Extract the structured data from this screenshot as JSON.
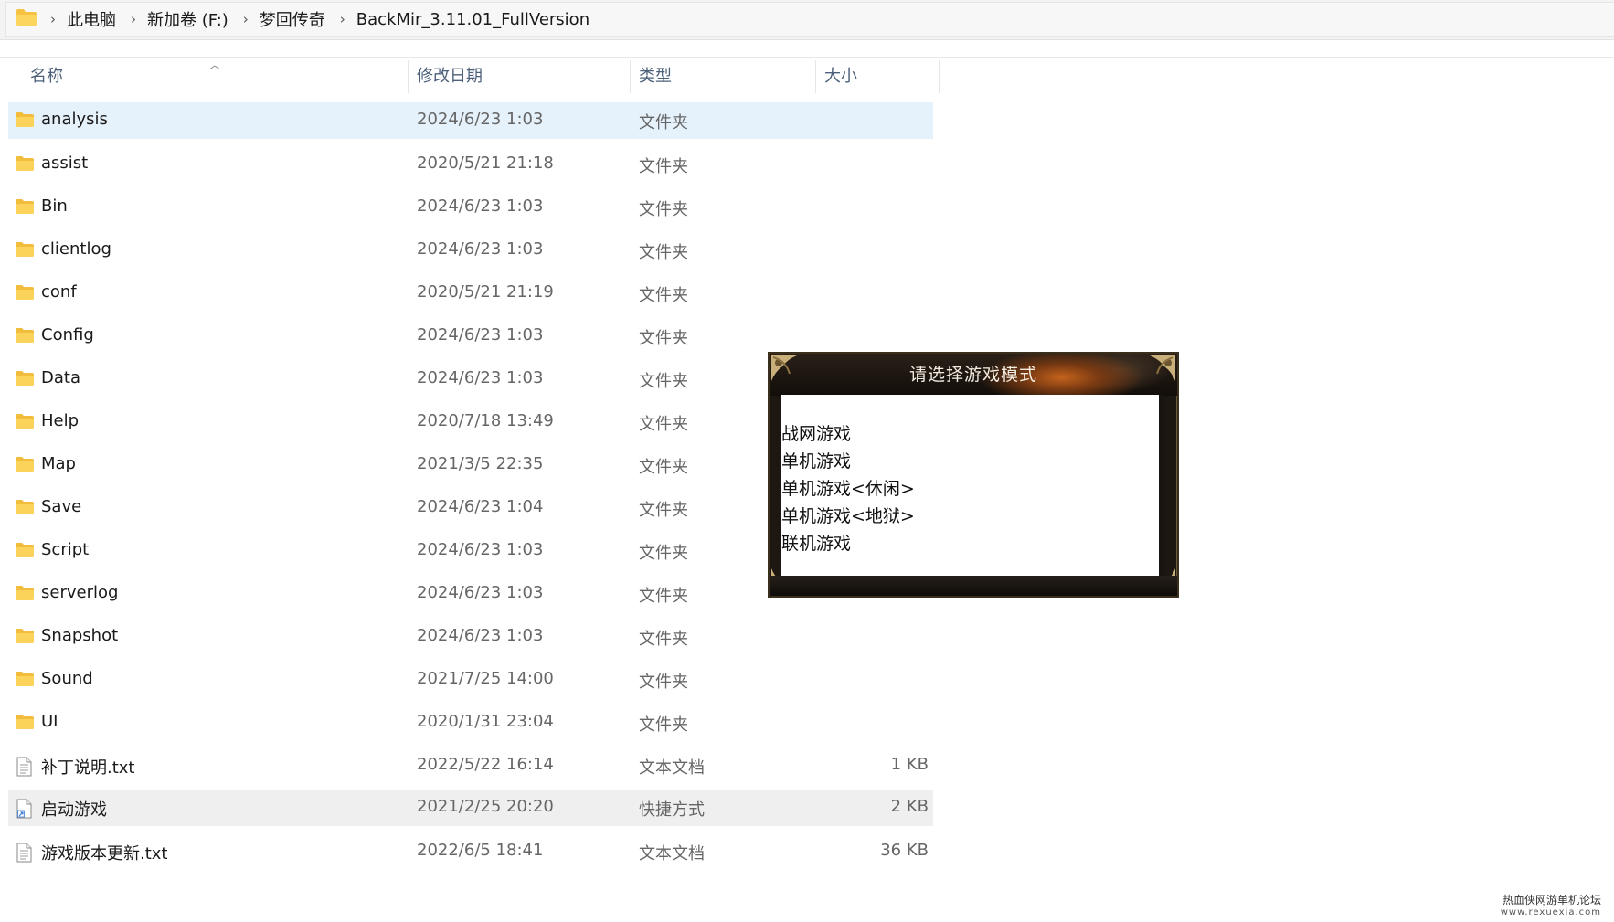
{
  "breadcrumb": [
    "此电脑",
    "新加卷 (F:)",
    "梦回传奇",
    "BackMir_3.11.01_FullVersion"
  ],
  "columns": {
    "name": "名称",
    "date": "修改日期",
    "type": "类型",
    "size": "大小"
  },
  "files": [
    {
      "name": "analysis",
      "date": "2024/6/23 1:03",
      "type": "文件夹",
      "size": "",
      "icon": "folder-icon"
    },
    {
      "name": "assist",
      "date": "2020/5/21 21:18",
      "type": "文件夹",
      "size": "",
      "icon": "folder-icon"
    },
    {
      "name": "Bin",
      "date": "2024/6/23 1:03",
      "type": "文件夹",
      "size": "",
      "icon": "folder-icon"
    },
    {
      "name": "clientlog",
      "date": "2024/6/23 1:03",
      "type": "文件夹",
      "size": "",
      "icon": "folder-icon"
    },
    {
      "name": "conf",
      "date": "2020/5/21 21:19",
      "type": "文件夹",
      "size": "",
      "icon": "folder-icon"
    },
    {
      "name": "Config",
      "date": "2024/6/23 1:03",
      "type": "文件夹",
      "size": "",
      "icon": "folder-icon"
    },
    {
      "name": "Data",
      "date": "2024/6/23 1:03",
      "type": "文件夹",
      "size": "",
      "icon": "folder-icon"
    },
    {
      "name": "Help",
      "date": "2020/7/18 13:49",
      "type": "文件夹",
      "size": "",
      "icon": "folder-icon"
    },
    {
      "name": "Map",
      "date": "2021/3/5 22:35",
      "type": "文件夹",
      "size": "",
      "icon": "folder-icon"
    },
    {
      "name": "Save",
      "date": "2024/6/23 1:04",
      "type": "文件夹",
      "size": "",
      "icon": "folder-icon"
    },
    {
      "name": "Script",
      "date": "2024/6/23 1:03",
      "type": "文件夹",
      "size": "",
      "icon": "folder-icon"
    },
    {
      "name": "serverlog",
      "date": "2024/6/23 1:03",
      "type": "文件夹",
      "size": "",
      "icon": "folder-icon"
    },
    {
      "name": "Snapshot",
      "date": "2024/6/23 1:03",
      "type": "文件夹",
      "size": "",
      "icon": "folder-icon"
    },
    {
      "name": "Sound",
      "date": "2021/7/25 14:00",
      "type": "文件夹",
      "size": "",
      "icon": "folder-icon"
    },
    {
      "name": "UI",
      "date": "2020/1/31 23:04",
      "type": "文件夹",
      "size": "",
      "icon": "folder-icon"
    },
    {
      "name": "补丁说明.txt",
      "date": "2022/5/22 16:14",
      "type": "文本文档",
      "size": "1 KB",
      "icon": "text-file-icon"
    },
    {
      "name": "启动游戏",
      "date": "2021/2/25 20:20",
      "type": "快捷方式",
      "size": "2 KB",
      "icon": "shortcut-icon"
    },
    {
      "name": "游戏版本更新.txt",
      "date": "2022/6/5 18:41",
      "type": "文本文档",
      "size": "36 KB",
      "icon": "text-file-icon"
    }
  ],
  "selected_index": 0,
  "hover_index": 16,
  "dialog": {
    "title": "请选择游戏模式",
    "options": [
      "战网游戏",
      "单机游戏",
      "单机游戏<休闲>",
      "单机游戏<地狱>",
      "联机游戏"
    ]
  },
  "watermark": {
    "line1": "热血侠网游单机论坛",
    "line2": "www.rexuexia.com"
  },
  "colors": {
    "selected_row": "#e5f1fb",
    "hover_row": "#efefef",
    "header_text": "#4c607a",
    "folder": "#f7c948"
  }
}
